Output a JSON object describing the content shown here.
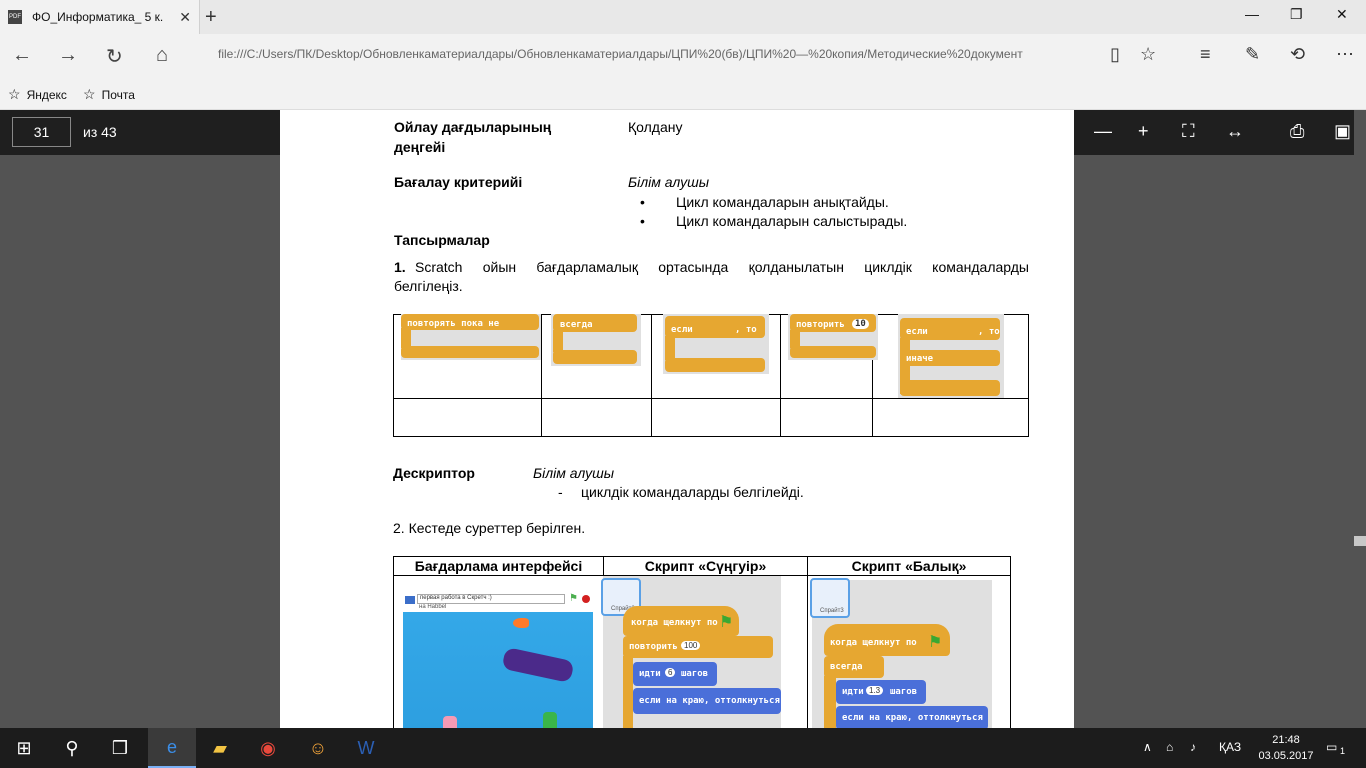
{
  "browser": {
    "tab_title": "ФО_Информатика_ 5 к.",
    "tab_icon": "PDF",
    "url": "file:///C:/Users/ПК/Desktop/Обновленкаматериалдары/Обновленкаматериалдары/ЦПИ%20(бв)/ЦПИ%20—%20копия/Методические%20документ",
    "favorites": [
      "Яндекс",
      "Почта"
    ]
  },
  "pdf_toolbar": {
    "page_current": "31",
    "page_total": "из 43"
  },
  "document": {
    "thinking_label": "Ойлау дағдыларының",
    "thinking_label2": "деңгейі",
    "thinking_value": "Қолдану",
    "criteria_label": "Бағалау критерийі",
    "criteria_intro": "Білім алушы",
    "criteria_items": [
      "Цикл командаларын анықтайды.",
      "Цикл командаларын салыстырады."
    ],
    "tasks_label": "Тапсырмалар",
    "task1_num": "1.",
    "task1_line1": "Scratch ойын бағдарламалық ортасында қолданылатын циклдік командаларды",
    "task1_line2": "белгілеңіз.",
    "blocks": [
      {
        "line1": "повторять пока не",
        "line2": ""
      },
      {
        "line1": "всегда",
        "line2": ""
      },
      {
        "line1": "если",
        "line1b": ", то",
        "line2": ""
      },
      {
        "line1": "повторить",
        "value": "10",
        "line2": ""
      },
      {
        "line1": "если",
        "line1b": ", то",
        "line2": "иначе"
      }
    ],
    "descriptor_label": "Дескриптор",
    "descriptor_intro": "Білім алушы",
    "descriptor_item": "циклдік командаларды белгілейді.",
    "task2": "2. Кестеде суреттер берілген.",
    "table2_headers": [
      "Бағдарлама интерфейсі",
      "Скрипт «Сүңгуір»",
      "Скрипт «Балық»"
    ],
    "stage_text1": "первая работа в Скретч :)",
    "stage_text2": "на Habbel",
    "script_diver": [
      "когда щелкнут по",
      "повторить",
      "100",
      "идти",
      "6",
      "шагов",
      "если на краю, оттолкнуться"
    ],
    "script_fish": [
      "когда щелкнут по",
      "всегда",
      "идти",
      "1.3",
      "шагов",
      "если на краю, оттолкнуться"
    ],
    "sprite1": "Спрайт2",
    "sprite2": "Спрайт3"
  },
  "taskbar": {
    "lang": "ҚАЗ",
    "time": "21:48",
    "date": "03.05.2017",
    "notifications": "1"
  }
}
